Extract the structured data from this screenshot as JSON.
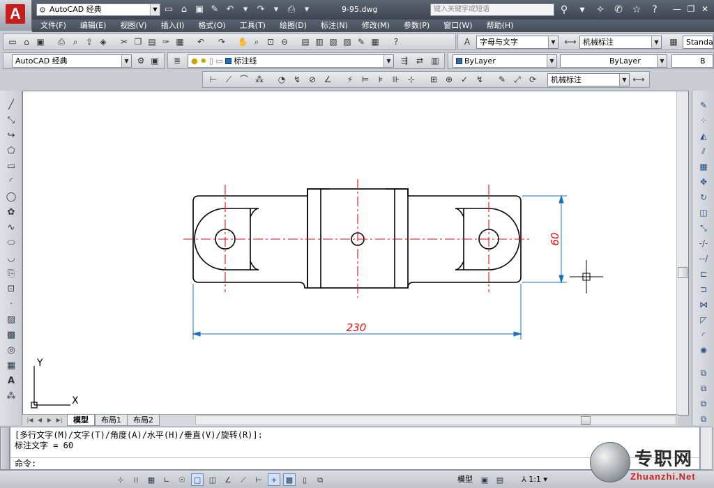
{
  "titlebar": {
    "app_logo": "A",
    "workspace": "AutoCAD 经典",
    "doc_title": "9-95.dwg",
    "search_placeholder": "键入关键字或短语"
  },
  "menubar": [
    "文件(F)",
    "编辑(E)",
    "视图(V)",
    "插入(I)",
    "格式(O)",
    "工具(T)",
    "绘图(D)",
    "标注(N)",
    "修改(M)",
    "参数(P)",
    "窗口(W)",
    "帮助(H)"
  ],
  "toolbars": {
    "text_style": "字母与文字",
    "dim_style": "机械标注",
    "table_style": "Standa",
    "workspace_combo": "AutoCAD 经典",
    "layer": "标注线",
    "color": "ByLayer",
    "linetype": "ByLayer",
    "lineweight": "B",
    "dim_style_2": "机械标注"
  },
  "drawing": {
    "dim_vertical": "60",
    "dim_horizontal": "230",
    "ucs_x": "X",
    "ucs_y": "Y",
    "colors": {
      "outline": "#000000",
      "center": "#e01010",
      "dimension": "#1a6fc0"
    }
  },
  "tabs": [
    "模型",
    "布局1",
    "布局2"
  ],
  "command": {
    "history_1": "[多行文字(M)/文字(T)/角度(A)/水平(H)/垂直(V)/旋转(R)]:",
    "history_2": "标注文字 = 60",
    "prompt": "命令:"
  },
  "status": {
    "model_label": "模型",
    "scale": "1:1"
  },
  "watermark": {
    "cn": "专职网",
    "en": "Zhuanzhi.Net"
  }
}
